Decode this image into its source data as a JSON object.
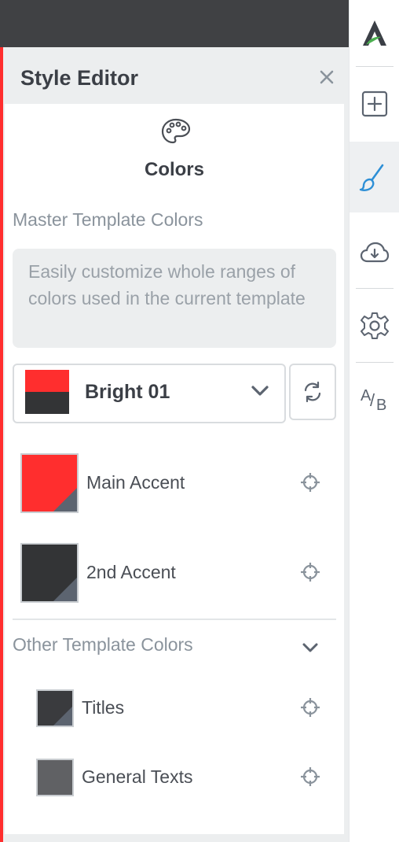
{
  "panel": {
    "title": "Style Editor",
    "section_title": "Colors",
    "master_heading": "Master Template Colors",
    "info_text": "Easily customize whole ranges of colors used in the current template",
    "preset": {
      "label": "Bright 01",
      "top_color": "#ff2e2e",
      "bottom_color": "#333436"
    },
    "master_colors": [
      {
        "label": "Main Accent",
        "color": "#ff2e2e"
      },
      {
        "label": "2nd Accent",
        "color": "#333436"
      }
    ],
    "other_heading": "Other Template Colors",
    "other_colors": [
      {
        "label": "Titles",
        "color": "#3a3b3e"
      },
      {
        "label": "General Texts",
        "color": "#606164"
      }
    ]
  },
  "sidebar": {
    "items": [
      "logo-icon",
      "add-icon",
      "brush-icon",
      "cloud-download-icon",
      "gear-icon"
    ],
    "ab_label_a": "A",
    "ab_label_b": "B"
  },
  "colors": {
    "accent": "#2d8fd6",
    "active_bg": "#eef0f2",
    "danger": "#ff2e2e"
  }
}
